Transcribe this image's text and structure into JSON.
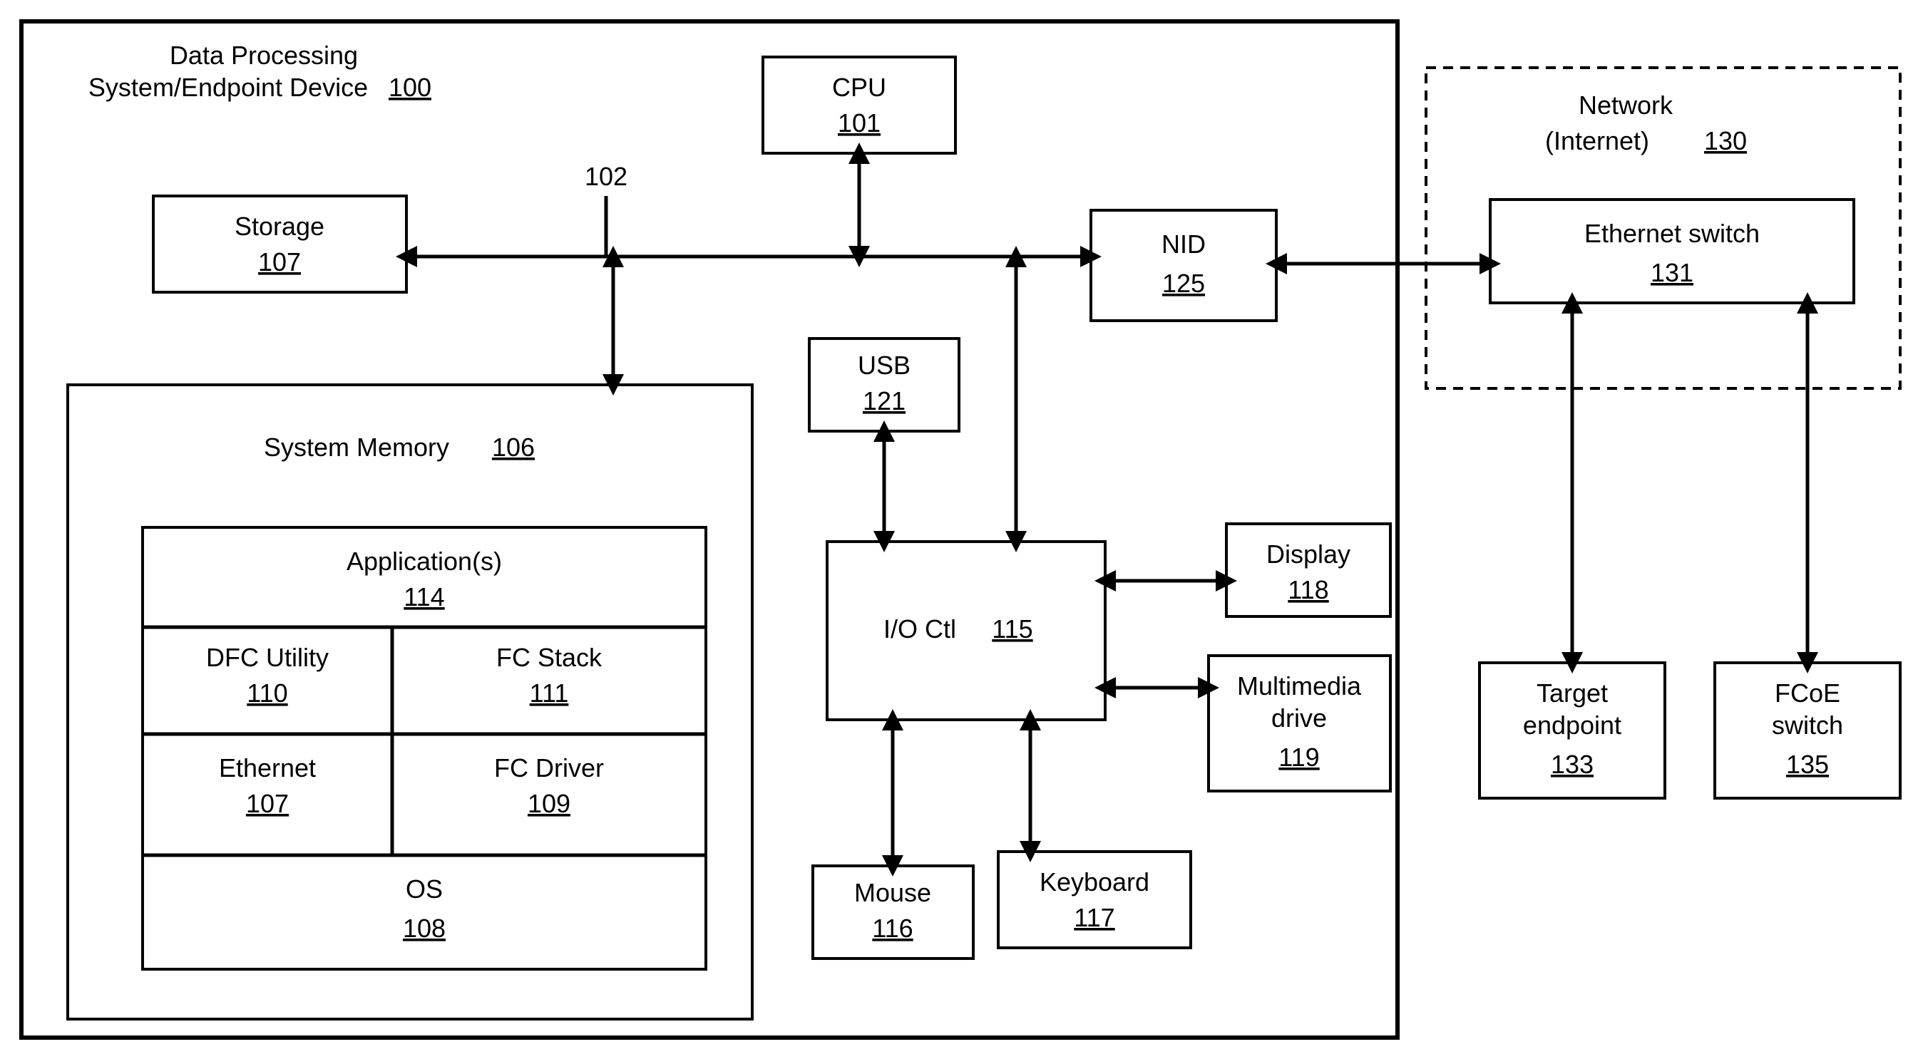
{
  "device": {
    "title": "Data Processing",
    "subtitle": "System/Endpoint Device",
    "ref": "100"
  },
  "cpu": {
    "label": "CPU",
    "ref": "101"
  },
  "bus": {
    "ref": "102"
  },
  "storage": {
    "label": "Storage",
    "ref": "107"
  },
  "sysmem": {
    "label": "System Memory",
    "ref": "106"
  },
  "apps": {
    "label": "Application(s)",
    "ref": "114"
  },
  "dfc": {
    "label": "DFC Utility",
    "ref": "110"
  },
  "fcstack": {
    "label": "FC Stack",
    "ref": "111"
  },
  "eth": {
    "label": "Ethernet",
    "ref": "107"
  },
  "fcdrv": {
    "label": "FC Driver",
    "ref": "109"
  },
  "os": {
    "label": "OS",
    "ref": "108"
  },
  "usb": {
    "label": "USB",
    "ref": "121"
  },
  "ioctl": {
    "label": "I/O Ctl",
    "ref": "115"
  },
  "mouse": {
    "label": "Mouse",
    "ref": "116"
  },
  "kbd": {
    "label": "Keyboard",
    "ref": "117"
  },
  "disp": {
    "label": "Display",
    "ref": "118"
  },
  "mm": {
    "label1": "Multimedia",
    "label2": "drive",
    "ref": "119"
  },
  "nid": {
    "label": "NID",
    "ref": "125"
  },
  "net": {
    "label": "Network",
    "sublabel": "(Internet)",
    "ref": "130"
  },
  "esw": {
    "label": "Ethernet switch",
    "ref": "131"
  },
  "tgt": {
    "label1": "Target",
    "label2": "endpoint",
    "ref": "133"
  },
  "fcoe": {
    "label1": "FCoE",
    "label2": "switch",
    "ref": "135"
  }
}
